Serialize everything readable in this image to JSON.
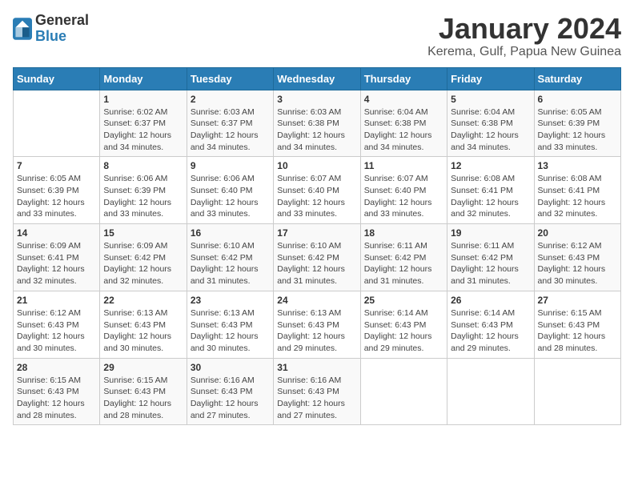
{
  "header": {
    "logo_general": "General",
    "logo_blue": "Blue",
    "month_year": "January 2024",
    "location": "Kerema, Gulf, Papua New Guinea"
  },
  "weekdays": [
    "Sunday",
    "Monday",
    "Tuesday",
    "Wednesday",
    "Thursday",
    "Friday",
    "Saturday"
  ],
  "weeks": [
    [
      {
        "day": "",
        "info": ""
      },
      {
        "day": "1",
        "info": "Sunrise: 6:02 AM\nSunset: 6:37 PM\nDaylight: 12 hours\nand 34 minutes."
      },
      {
        "day": "2",
        "info": "Sunrise: 6:03 AM\nSunset: 6:37 PM\nDaylight: 12 hours\nand 34 minutes."
      },
      {
        "day": "3",
        "info": "Sunrise: 6:03 AM\nSunset: 6:38 PM\nDaylight: 12 hours\nand 34 minutes."
      },
      {
        "day": "4",
        "info": "Sunrise: 6:04 AM\nSunset: 6:38 PM\nDaylight: 12 hours\nand 34 minutes."
      },
      {
        "day": "5",
        "info": "Sunrise: 6:04 AM\nSunset: 6:38 PM\nDaylight: 12 hours\nand 34 minutes."
      },
      {
        "day": "6",
        "info": "Sunrise: 6:05 AM\nSunset: 6:39 PM\nDaylight: 12 hours\nand 33 minutes."
      }
    ],
    [
      {
        "day": "7",
        "info": "Sunrise: 6:05 AM\nSunset: 6:39 PM\nDaylight: 12 hours\nand 33 minutes."
      },
      {
        "day": "8",
        "info": "Sunrise: 6:06 AM\nSunset: 6:39 PM\nDaylight: 12 hours\nand 33 minutes."
      },
      {
        "day": "9",
        "info": "Sunrise: 6:06 AM\nSunset: 6:40 PM\nDaylight: 12 hours\nand 33 minutes."
      },
      {
        "day": "10",
        "info": "Sunrise: 6:07 AM\nSunset: 6:40 PM\nDaylight: 12 hours\nand 33 minutes."
      },
      {
        "day": "11",
        "info": "Sunrise: 6:07 AM\nSunset: 6:40 PM\nDaylight: 12 hours\nand 33 minutes."
      },
      {
        "day": "12",
        "info": "Sunrise: 6:08 AM\nSunset: 6:41 PM\nDaylight: 12 hours\nand 32 minutes."
      },
      {
        "day": "13",
        "info": "Sunrise: 6:08 AM\nSunset: 6:41 PM\nDaylight: 12 hours\nand 32 minutes."
      }
    ],
    [
      {
        "day": "14",
        "info": "Sunrise: 6:09 AM\nSunset: 6:41 PM\nDaylight: 12 hours\nand 32 minutes."
      },
      {
        "day": "15",
        "info": "Sunrise: 6:09 AM\nSunset: 6:42 PM\nDaylight: 12 hours\nand 32 minutes."
      },
      {
        "day": "16",
        "info": "Sunrise: 6:10 AM\nSunset: 6:42 PM\nDaylight: 12 hours\nand 31 minutes."
      },
      {
        "day": "17",
        "info": "Sunrise: 6:10 AM\nSunset: 6:42 PM\nDaylight: 12 hours\nand 31 minutes."
      },
      {
        "day": "18",
        "info": "Sunrise: 6:11 AM\nSunset: 6:42 PM\nDaylight: 12 hours\nand 31 minutes."
      },
      {
        "day": "19",
        "info": "Sunrise: 6:11 AM\nSunset: 6:42 PM\nDaylight: 12 hours\nand 31 minutes."
      },
      {
        "day": "20",
        "info": "Sunrise: 6:12 AM\nSunset: 6:43 PM\nDaylight: 12 hours\nand 30 minutes."
      }
    ],
    [
      {
        "day": "21",
        "info": "Sunrise: 6:12 AM\nSunset: 6:43 PM\nDaylight: 12 hours\nand 30 minutes."
      },
      {
        "day": "22",
        "info": "Sunrise: 6:13 AM\nSunset: 6:43 PM\nDaylight: 12 hours\nand 30 minutes."
      },
      {
        "day": "23",
        "info": "Sunrise: 6:13 AM\nSunset: 6:43 PM\nDaylight: 12 hours\nand 30 minutes."
      },
      {
        "day": "24",
        "info": "Sunrise: 6:13 AM\nSunset: 6:43 PM\nDaylight: 12 hours\nand 29 minutes."
      },
      {
        "day": "25",
        "info": "Sunrise: 6:14 AM\nSunset: 6:43 PM\nDaylight: 12 hours\nand 29 minutes."
      },
      {
        "day": "26",
        "info": "Sunrise: 6:14 AM\nSunset: 6:43 PM\nDaylight: 12 hours\nand 29 minutes."
      },
      {
        "day": "27",
        "info": "Sunrise: 6:15 AM\nSunset: 6:43 PM\nDaylight: 12 hours\nand 28 minutes."
      }
    ],
    [
      {
        "day": "28",
        "info": "Sunrise: 6:15 AM\nSunset: 6:43 PM\nDaylight: 12 hours\nand 28 minutes."
      },
      {
        "day": "29",
        "info": "Sunrise: 6:15 AM\nSunset: 6:43 PM\nDaylight: 12 hours\nand 28 minutes."
      },
      {
        "day": "30",
        "info": "Sunrise: 6:16 AM\nSunset: 6:43 PM\nDaylight: 12 hours\nand 27 minutes."
      },
      {
        "day": "31",
        "info": "Sunrise: 6:16 AM\nSunset: 6:43 PM\nDaylight: 12 hours\nand 27 minutes."
      },
      {
        "day": "",
        "info": ""
      },
      {
        "day": "",
        "info": ""
      },
      {
        "day": "",
        "info": ""
      }
    ]
  ]
}
